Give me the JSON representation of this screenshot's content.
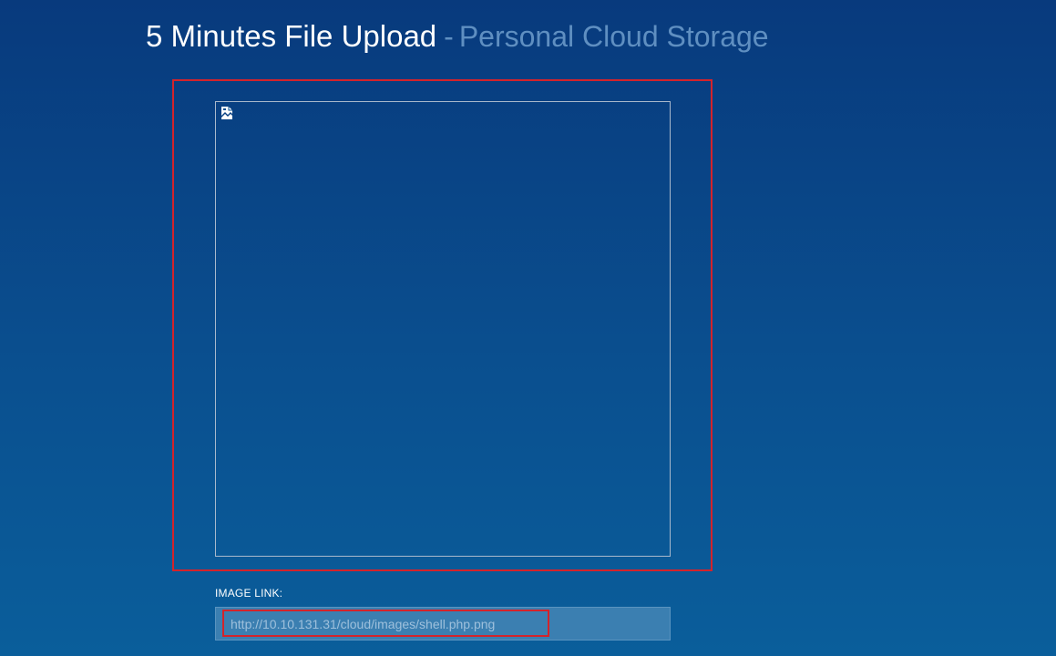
{
  "header": {
    "title": "5 Minutes File Upload",
    "separator": "-",
    "subtitle": "Personal Cloud Storage"
  },
  "preview": {
    "broken_image_icon": "broken-image-icon"
  },
  "image_link": {
    "label": "IMAGE LINK:",
    "value": "http://10.10.131.31/cloud/images/shell.php.png"
  },
  "colors": {
    "background_top": "#083a7d",
    "background_bottom": "#0a5e9b",
    "annotation": "#d4232b",
    "subtitle": "#5f8fc1",
    "input_bg": "#3b7fb1"
  }
}
